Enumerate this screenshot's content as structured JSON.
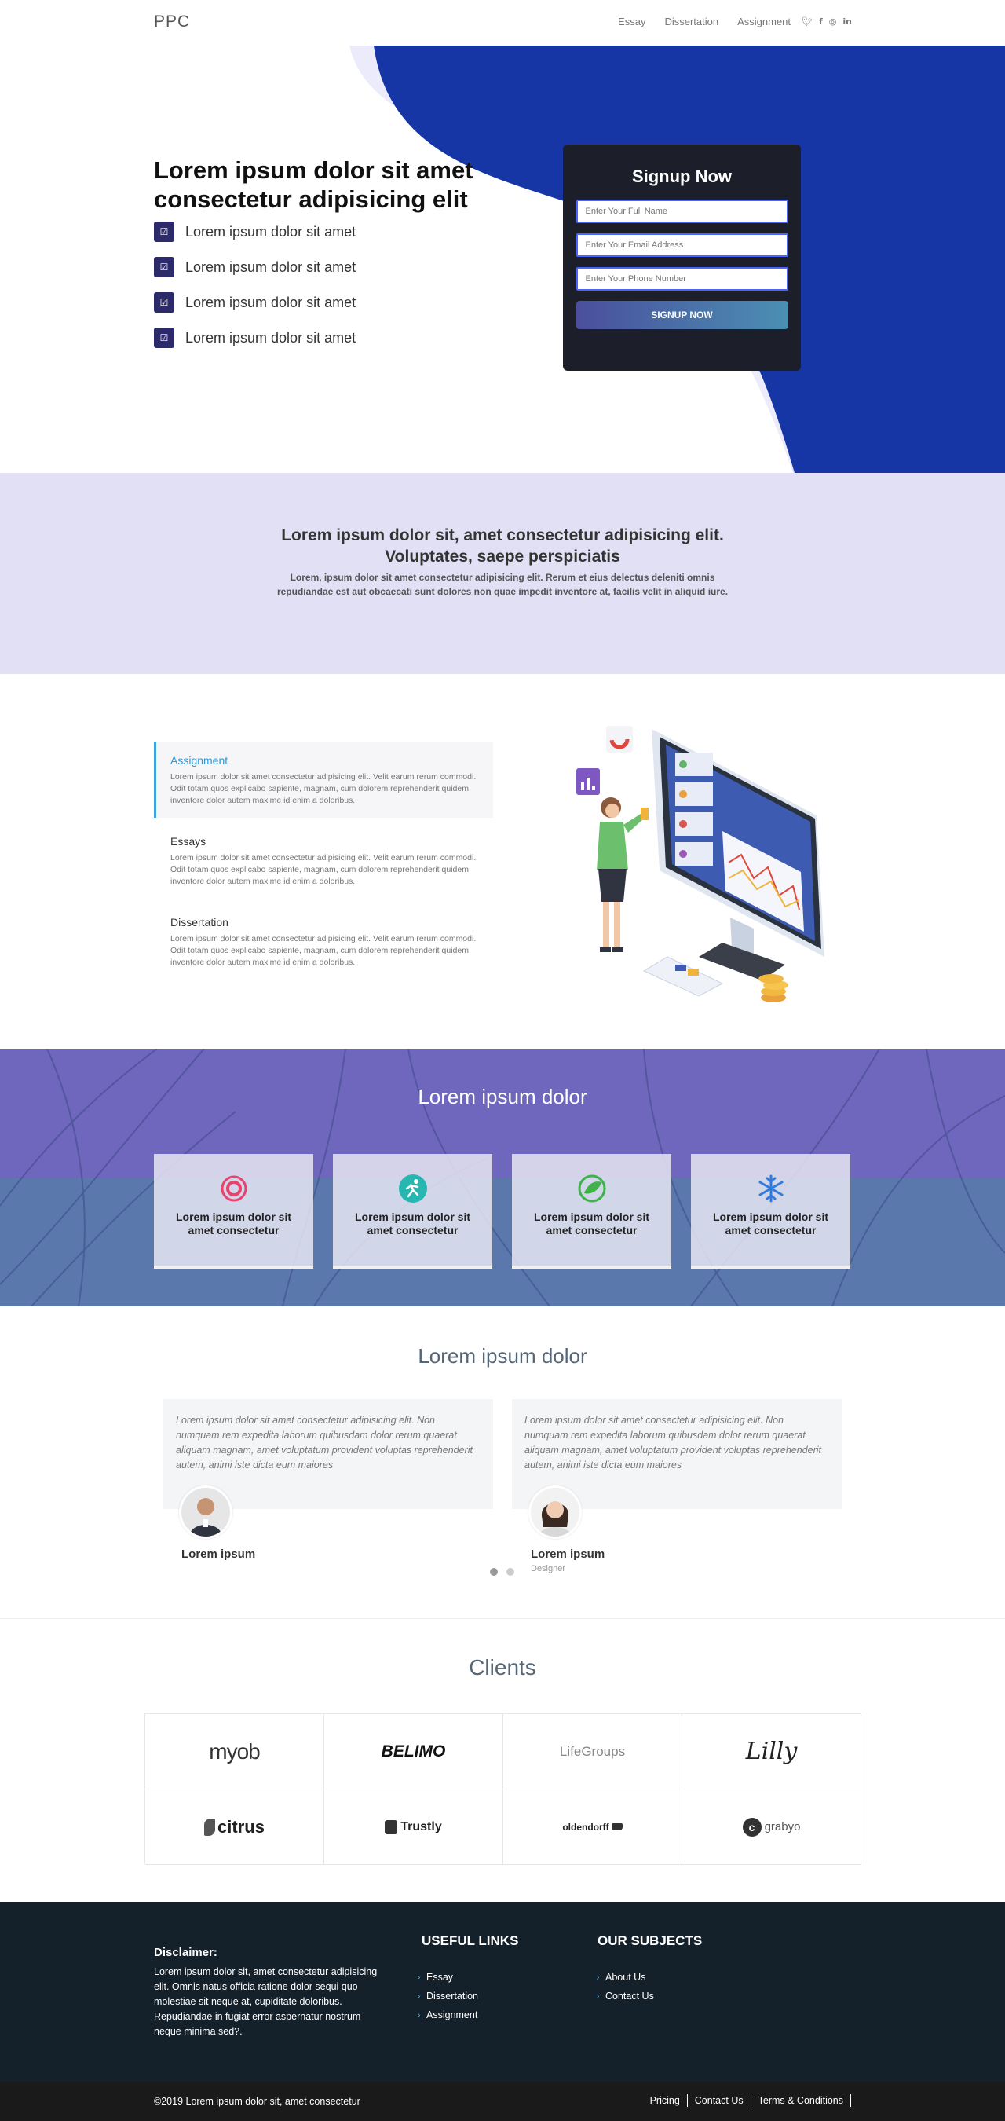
{
  "nav": {
    "logo": "PPC",
    "links": [
      "Essay",
      "Dissertation",
      "Assignment"
    ],
    "social_icons": [
      "twitter-icon",
      "facebook-icon",
      "instagram-icon",
      "linkedin-icon"
    ]
  },
  "hero": {
    "title": "Lorem ipsum dolor sit amet consectetur adipisicing elit",
    "checks": [
      "Lorem ipsum dolor sit amet",
      "Lorem ipsum dolor sit amet",
      "Lorem ipsum dolor sit amet",
      "Lorem ipsum dolor sit amet"
    ],
    "signup": {
      "title": "Signup Now",
      "name_placeholder": "Enter Your Full Name",
      "email_placeholder": "Enter Your Email Address",
      "phone_placeholder": "Enter Your Phone Number",
      "button": "SIGNUP NOW"
    },
    "colors": {
      "blue_shape": "#1636a6",
      "lavender_shape": "#ecebfb",
      "checkbox": "#2d2a6b"
    }
  },
  "intro": {
    "title": "Lorem ipsum dolor sit, amet consectetur adipisicing elit. Voluptates, saepe perspiciatis",
    "text": "Lorem, ipsum dolor sit amet consectetur adipisicing elit. Rerum et eius delectus deleniti omnis repudiandae est aut obcaecati sunt dolores non quae impedit inventore at, facilis velit in aliquid iure."
  },
  "services": [
    {
      "title": "Assignment",
      "text": "Lorem ipsum dolor sit amet consectetur adipisicing elit. Velit earum rerum commodi. Odit totam quos explicabo sapiente, magnam, cum dolorem reprehenderit quidem inventore dolor autem maxime id enim a doloribus.",
      "active": true
    },
    {
      "title": "Essays",
      "text": "Lorem ipsum dolor sit amet consectetur adipisicing elit. Velit earum rerum commodi. Odit totam quos explicabo sapiente, magnam, cum dolorem reprehenderit quidem inventore dolor autem maxime id enim a doloribus.",
      "active": false
    },
    {
      "title": "Dissertation",
      "text": "Lorem ipsum dolor sit amet consectetur adipisicing elit. Velit earum rerum commodi. Odit totam quos explicabo sapiente, magnam, cum dolorem reprehenderit quidem inventore dolor autem maxime id enim a doloribus.",
      "active": false
    }
  ],
  "features": {
    "title": "Lorem ipsum dolor",
    "cards": [
      {
        "icon": "ring-icon",
        "text": "Lorem ipsum dolor sit amet consectetur"
      },
      {
        "icon": "runner-icon",
        "text": "Lorem ipsum dolor sit amet consectetur"
      },
      {
        "icon": "leaf-icon",
        "text": "Lorem ipsum dolor sit amet consectetur"
      },
      {
        "icon": "snowflake-icon",
        "text": "Lorem ipsum dolor sit amet consectetur"
      }
    ]
  },
  "testimonials": {
    "title": "Lorem ipsum dolor",
    "items": [
      {
        "quote": "Lorem ipsum dolor sit amet consectetur adipisicing elit. Non numquam rem expedita laborum quibusdam dolor rerum quaerat aliquam magnam, amet voluptatum provident voluptas reprehenderit autem, animi iste dicta eum maiores",
        "name": "Lorem ipsum",
        "role": ""
      },
      {
        "quote": "Lorem ipsum dolor sit amet consectetur adipisicing elit. Non numquam rem expedita laborum quibusdam dolor rerum quaerat aliquam magnam, amet voluptatum provident voluptas reprehenderit autem, animi iste dicta eum maiores",
        "name": "Lorem ipsum",
        "role": "Designer"
      }
    ]
  },
  "clients": {
    "title": "Clients",
    "logos": [
      "myob",
      "BELIMO",
      "LifeGroups",
      "Lilly",
      "citrus",
      "Trustly",
      "oldendorff",
      "grabyo"
    ]
  },
  "footer": {
    "disclaimer_title": "Disclaimer:",
    "disclaimer_text": "Lorem ipsum dolor sit, amet consectetur adipisicing elit. Omnis natus officia ratione dolor sequi quo molestiae sit neque at, cupiditate doloribus. Repudiandae in fugiat error aspernatur nostrum neque minima sed?.",
    "useful_title": "USEFUL LINKS",
    "useful_links": [
      "Essay",
      "Dissertation",
      "Assignment"
    ],
    "subjects_title": "OUR SUBJECTS",
    "subjects_links": [
      "About Us",
      "Contact Us"
    ],
    "copyright": "©2019 Lorem ipsum dolor sit, amet consectetur",
    "bottom_links": [
      "Pricing",
      "Contact Us",
      "Terms & Conditions"
    ]
  }
}
